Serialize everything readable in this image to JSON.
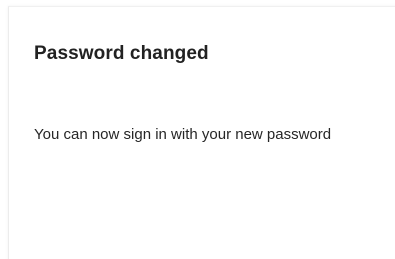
{
  "dialog": {
    "title": "Password changed",
    "message": "You can now sign in with your new password"
  }
}
